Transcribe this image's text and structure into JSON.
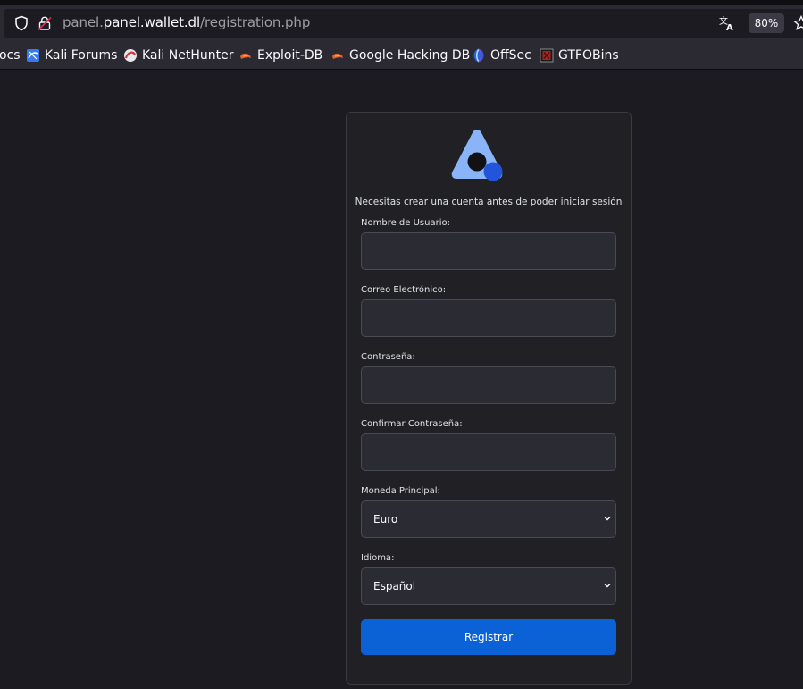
{
  "browser": {
    "url_host": "panel.wallet.dl",
    "url_path": "/registration.php",
    "zoom": "80%",
    "url_prefix": "panel."
  },
  "bookmarks": [
    {
      "label": "ocs",
      "icon": "docs-icon"
    },
    {
      "label": "Kali Forums",
      "icon": "kali-forums-icon"
    },
    {
      "label": "Kali NetHunter",
      "icon": "kali-nethunter-icon"
    },
    {
      "label": "Exploit-DB",
      "icon": "exploit-db-icon"
    },
    {
      "label": "Google Hacking DB",
      "icon": "ghdb-icon"
    },
    {
      "label": "OffSec",
      "icon": "offsec-icon"
    },
    {
      "label": "GTFOBins",
      "icon": "gtfobins-icon"
    }
  ],
  "form": {
    "intro": "Necesitas crear una cuenta antes de poder iniciar sesión",
    "username_label": "Nombre de Usuario:",
    "email_label": "Correo Electrónico:",
    "password_label": "Contraseña:",
    "confirm_label": "Confirmar Contraseña:",
    "currency_label": "Moneda Principal:",
    "currency_value": "Euro",
    "language_label": "Idioma:",
    "language_value": "Español",
    "submit_label": "Registrar"
  },
  "colors": {
    "accent": "#0a62d6",
    "logo_light": "#8ab4f8",
    "logo_dark": "#2255d9"
  }
}
